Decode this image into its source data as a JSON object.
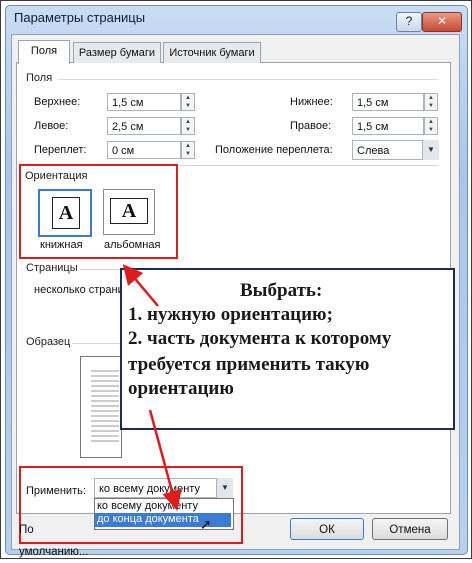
{
  "title": "Параметры страницы",
  "caption_buttons": {
    "help": "?",
    "close": "✕"
  },
  "tabs": [
    {
      "label": "Поля",
      "active": true
    },
    {
      "label": "Размер бумаги",
      "active": false
    },
    {
      "label": "Источник бумаги",
      "active": false
    }
  ],
  "margins": {
    "group": "Поля",
    "top": {
      "label": "Верхнее:",
      "value": "1,5 см"
    },
    "bottom": {
      "label": "Нижнее:",
      "value": "1,5 см"
    },
    "left": {
      "label": "Левое:",
      "value": "2,5 см"
    },
    "right": {
      "label": "Правое:",
      "value": "1,5 см"
    },
    "gutter": {
      "label": "Переплет:",
      "value": "0 см"
    },
    "gutter_pos": {
      "label": "Положение переплета:",
      "value": "Слева"
    }
  },
  "orientation": {
    "group": "Ориентация",
    "portrait": {
      "label": "книжная",
      "glyph": "A"
    },
    "landscape": {
      "label": "альбомная",
      "glyph": "A"
    }
  },
  "pages": {
    "group": "Страницы",
    "multiple_label": "несколько страни"
  },
  "preview": {
    "group": "Образец"
  },
  "apply": {
    "label": "Применить:",
    "value": "ко всему документу",
    "options": [
      "ко всему документу",
      "до конца документа"
    ]
  },
  "buttons": {
    "default": "По умолчанию...",
    "ok": "ОК",
    "cancel": "Отмена"
  },
  "callout": {
    "line1": "Выбрать:",
    "line2": "1. нужную ориентацию;",
    "line3": "2. часть документа к которому",
    "line4": "требуется применить такую",
    "line5": "ориентацию"
  },
  "colors": {
    "accent_red": "#e01b1b",
    "callout_border": "#1b2d57",
    "selection": "#3a7bd5"
  }
}
